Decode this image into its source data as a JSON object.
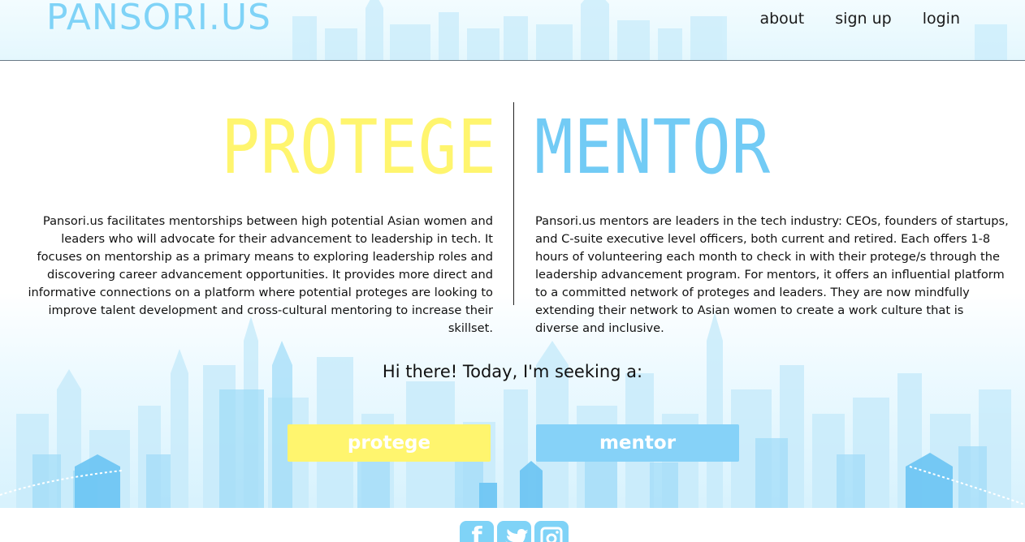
{
  "header": {
    "logo": "PANSORI.US",
    "nav": {
      "about": "about",
      "signup": "sign up",
      "login": "login"
    }
  },
  "roles": {
    "protege": {
      "title": "PROTEGE",
      "description": "Pansori.us facilitates mentorships between high potential Asian women and leaders who will advocate for their advancement to leadership in tech. It focuses on mentorship as a primary means to exploring leadership roles and discovering career advancement opportunities. It provides more direct and informative connections on a platform where potential proteges are looking to improve talent development and cross-cultural mentoring to increase their skillset."
    },
    "mentor": {
      "title": "MENTOR",
      "description": "Pansori.us mentors are leaders in the tech industry: CEOs, founders of startups, and C-suite executive level officers, both current and retired. Each offers 1-8 hours of volunteering each month to check in with their protege/s through the leadership advancement program. For mentors, it offers an influential platform to a committed network of proteges and leaders. They are now mindfully extending their network to Asian women to create a work culture that is diverse and inclusive."
    }
  },
  "prompt": "Hi there! Today, I'm seeking a:",
  "buttons": {
    "protege": "protege",
    "mentor": "mentor"
  },
  "footer": {
    "social_icons": [
      "facebook-icon",
      "twitter-icon",
      "instagram-icon"
    ]
  },
  "colors": {
    "protege_yellow": "#fff56e",
    "mentor_blue": "#72cbf5",
    "logo_blue": "#7fd3f7"
  }
}
